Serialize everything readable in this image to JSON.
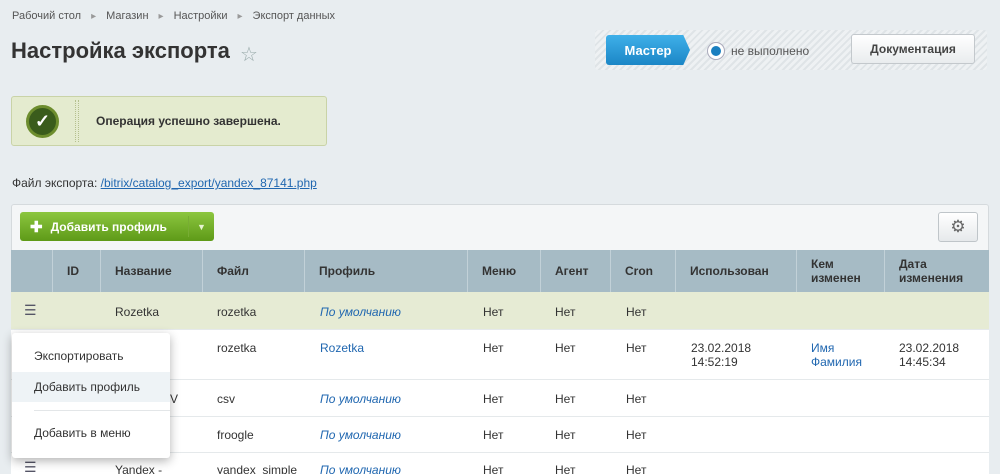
{
  "breadcrumb": [
    "Рабочий стол",
    "Магазин",
    "Настройки",
    "Экспорт данных"
  ],
  "page_title": "Настройка экспорта",
  "master": {
    "button_label": "Мастер",
    "status_text": "не выполнено",
    "docs_label": "Документация"
  },
  "notice": {
    "text": "Операция успешно завершена."
  },
  "export_file": {
    "label": "Файл экспорта:",
    "link": "/bitrix/catalog_export/yandex_87141.php"
  },
  "toolbar": {
    "add_profile_label": "Добавить профиль"
  },
  "columns": [
    "ID",
    "Название",
    "Файл",
    "Профиль",
    "Меню",
    "Агент",
    "Cron",
    "Использован",
    "Кем\nизменен",
    "Дата\nизменения"
  ],
  "rows": [
    {
      "name": "Rozetka",
      "file": "rozetka",
      "profile": "По умолчанию",
      "menu": "Нет",
      "agent": "Нет",
      "cron": "Нет",
      "used": "",
      "modified_by": "",
      "modified_at": ""
    },
    {
      "name": "",
      "file": "rozetka",
      "profile": "Rozetka",
      "menu": "Нет",
      "agent": "Нет",
      "cron": "Нет",
      "used": "23.02.2018\n14:52:19",
      "modified_by": "Имя\nФамилия",
      "modified_at": "23.02.2018\n14:45:34"
    },
    {
      "name": "SV",
      "file": "csv",
      "profile": "По умолчанию",
      "menu": "Нет",
      "agent": "Нет",
      "cron": "Нет",
      "used": "",
      "modified_by": "",
      "modified_at": ""
    },
    {
      "name": "",
      "file": "froogle",
      "profile": "По умолчанию",
      "menu": "Нет",
      "agent": "Нет",
      "cron": "Нет",
      "used": "",
      "modified_by": "",
      "modified_at": ""
    },
    {
      "name": "Yandex -",
      "file": "yandex_simple",
      "profile": "По умолчанию",
      "menu": "Нет",
      "agent": "Нет",
      "cron": "Нет",
      "used": "",
      "modified_by": "",
      "modified_at": ""
    }
  ],
  "context_menu": [
    "Экспортировать",
    "Добавить профиль",
    "Добавить в меню"
  ],
  "colors": {
    "accent": "#1b86c6",
    "success": "#5e9a18",
    "header_bg": "#a6bbc5",
    "link": "#2067b0"
  }
}
